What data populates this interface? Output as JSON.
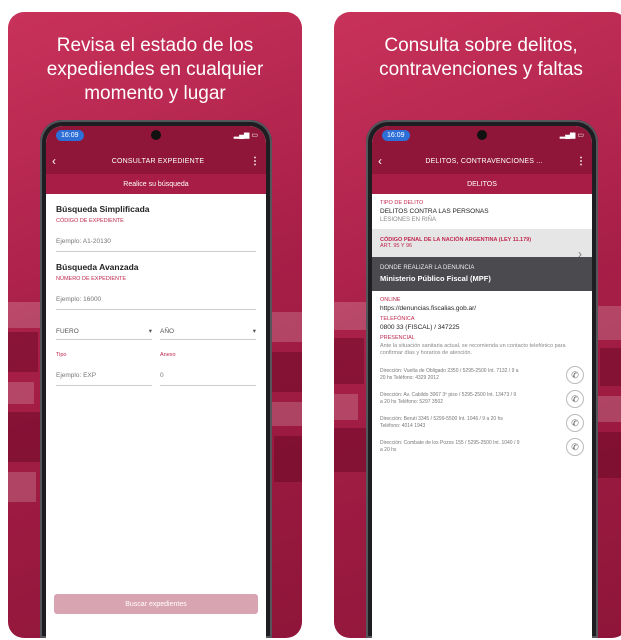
{
  "left": {
    "headline": "Revisa el estado de los expediendes en cualquier momento y lugar",
    "status_time": "16:09",
    "appbar_title": "CONSULTAR EXPEDIENTE",
    "subbar": "Realice su búsqueda",
    "simple": {
      "title": "Búsqueda Simplificada",
      "label": "CÓDIGO DE EXPEDIENTE",
      "placeholder": "Ejemplo: A1-20130"
    },
    "advanced": {
      "title": "Búsqueda Avanzada",
      "label": "NÚMERO DE EXPEDIENTE",
      "placeholder": "Ejemplo: 16000",
      "select_fuero": "FUERO",
      "select_anio": "AÑO",
      "tipo_label": "Tipo",
      "tipo_placeholder": "Ejemplo: EXP",
      "anexo_label": "Anexo",
      "anexo_placeholder": "0"
    },
    "button": "Buscar expedientes"
  },
  "right": {
    "headline": "Consulta sobre delitos, contravenciones y faltas",
    "status_time": "16:09",
    "appbar_title": "DELITOS, CONTRAVENCIONES ...",
    "subbar": "DELITOS",
    "tipo_label": "TIPO DE DELITO",
    "tipo_value": "DELITOS CONTRA LAS PERSONAS",
    "tipo_sub": "LESIONES EN RIÑA",
    "codigo_title": "CÓDIGO PENAL DE LA NACIÓN ARGENTINA (LEY 11.179)",
    "codigo_sub": "ART. 95 Y 96",
    "donde_label": "DÓNDE REALIZAR LA DENUNCIA",
    "donde_value": "Ministerio Público Fiscal (MPF)",
    "online_label": "ONLINE",
    "online_value": "https://denuncias.fiscalias.gob.ar/",
    "tel_label": "TELEFÓNICA",
    "tel_value": "0800 33 (FISCAL) / 347225",
    "pres_label": "PRESENCIAL",
    "pres_text": "Ante la situación sanitaria actual, se recomienda un contacto telefónico para confirmar días y horarios de atención.",
    "contacts": [
      "Dirección: Vuelta de Obligado 2350 / 5295-2500 Int. 7132 / 9 a 20 hs Teléfono: 4329 2012",
      "Dirección: Av. Cabildo 3067 3º piso / 5295-2500 Int. 13473 / 9 a 20 hs Teléfono: 5297 3502",
      "Dirección: Beruti 3345 / 5299-5500 Int. 1046 / 9 a 20 hs Teléfono: 4014 1943",
      "Dirección: Combate de los Pozos 155 / 5295-2500 Int. 1040 / 9 a 20 hs"
    ]
  }
}
